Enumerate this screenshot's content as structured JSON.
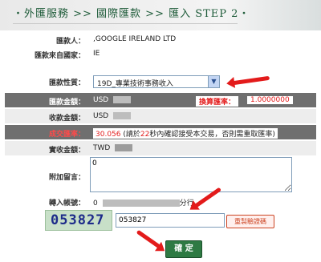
{
  "header": {
    "title": "・外匯服務 >> 國際匯款 >> 匯入 STEP 2・"
  },
  "form": {
    "remitter_label": "匯款人：",
    "remitter_value": ",GOOGLE IRELAND LTD",
    "country_label": "匯款來自國家：",
    "country_value": "IE",
    "nature_label": "匯款性質：",
    "nature_value": "19D_專業技術事務收入",
    "amount_label": "匯款金額：",
    "amount_currency": "USD",
    "rate_label": "換算匯率：",
    "rate_value": "1.0000000",
    "received_label": "收款金額：",
    "received_currency": "USD",
    "deal_rate_label": "成交匯率：",
    "deal_rate_value": "30.056",
    "deal_rate_note_a": "(請於",
    "deal_rate_note_seconds": "22",
    "deal_rate_note_b": "秒內確認接受本交易，否則需重取匯率)",
    "actual_label": "實收金額：",
    "actual_currency": "TWD",
    "message_label": "附加留言：",
    "message_value": "0",
    "account_label": "轉入帳號：",
    "account_prefix": "0",
    "account_suffix": "分行",
    "captcha_text": "053827",
    "captcha_input": "053827",
    "refresh_label": "重製驗證碼",
    "confirm_label": "確 定"
  },
  "colors": {
    "header_text": "#1e5b39",
    "warning": "#e31b1b",
    "confirm_bg": "#2e7a43"
  }
}
